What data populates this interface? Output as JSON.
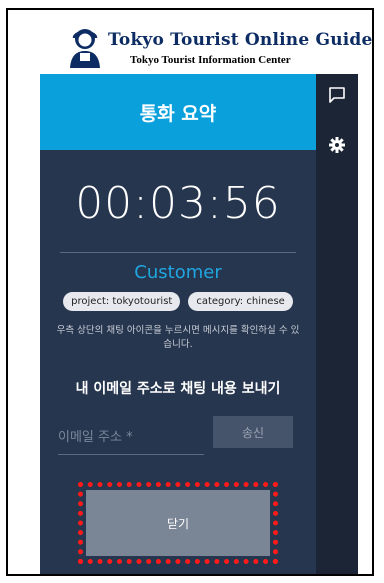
{
  "header": {
    "title": "Tokyo Tourist Online Guide",
    "subtitle": "Tokyo Tourist Information Center",
    "logo_icon": "person-support-icon"
  },
  "panel": {
    "title": "통화 요약",
    "timer": "00:03:56",
    "customer_label": "Customer",
    "tags": [
      {
        "label": "project: tokyotourist"
      },
      {
        "label": "category: chinese"
      }
    ],
    "info_text": "우측 상단의 채팅 아이콘을 누르시면 메시지를 확인하실 수 있습니다.",
    "send_title": "내 이메일 주소로 채팅 내용 보내기",
    "email": {
      "placeholder": "이메일 주소 *",
      "value": ""
    },
    "send_button": "송신",
    "close_button": "닫기"
  },
  "rail": {
    "icons": [
      "chat-icon",
      "gear-icon"
    ]
  },
  "colors": {
    "accent": "#0aa0dc",
    "panel_bg": "#27364f",
    "rail_bg": "#1c2536",
    "highlight": "#ff1a1a"
  }
}
